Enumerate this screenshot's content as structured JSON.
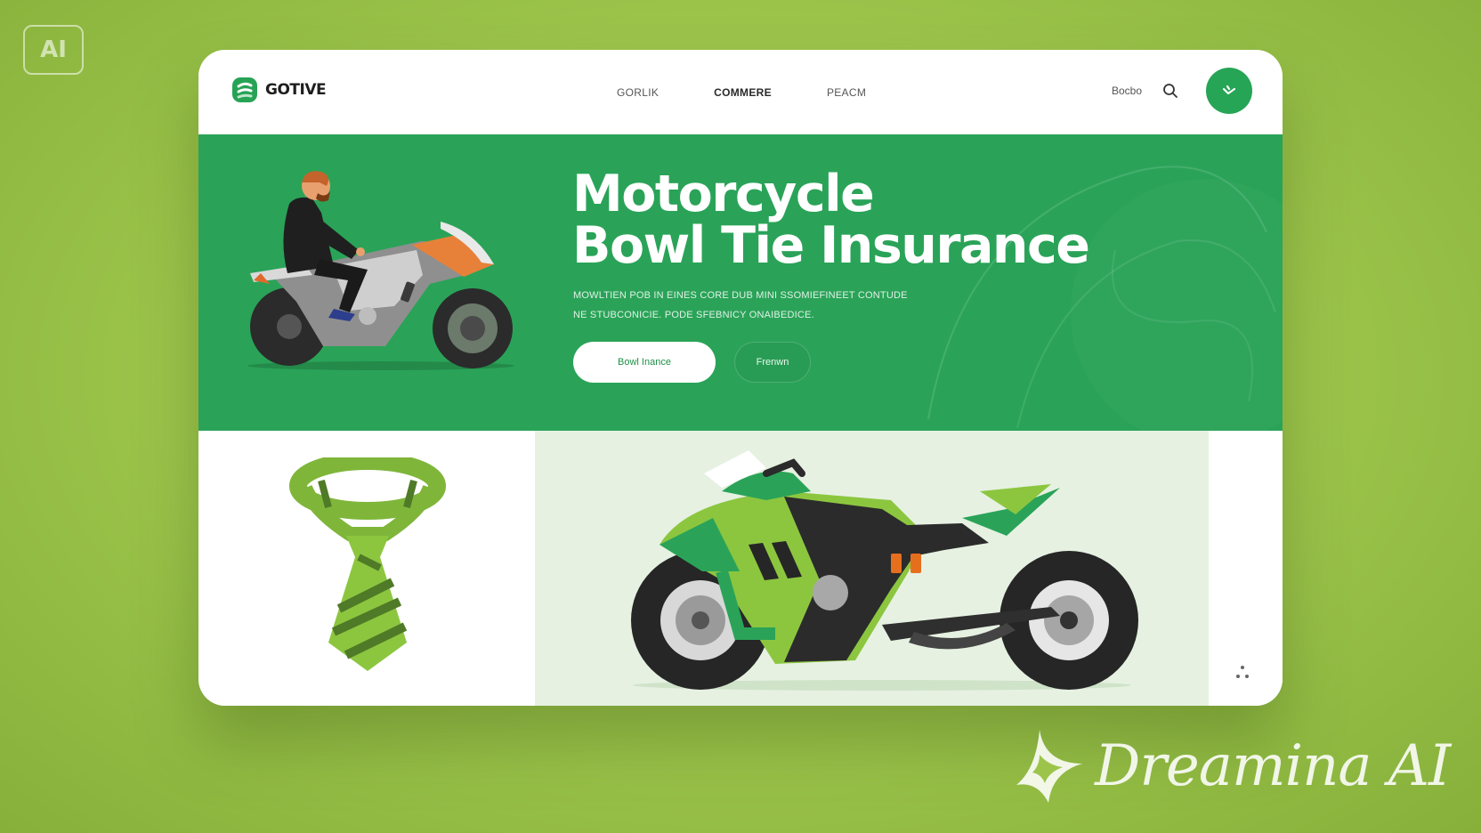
{
  "badge": {
    "text": "AI"
  },
  "nav": {
    "brand": "GOTIVE",
    "links": [
      "GORLIK",
      "COMMERE",
      "PEACM"
    ],
    "search_label": "Bocbo",
    "icons": {
      "search": "search-icon",
      "cta": "phone-icon"
    }
  },
  "hero": {
    "title_line1": "Motorcycle",
    "title_line2": "Bowl Tie Insurance",
    "subtitle_line1": "MOWLTIEN POB IN EINES CORE DUB MINI SSOMIEFINEET CONTUDE",
    "subtitle_line2": "NE STUBCONICIE. PODE SFEBNICY ONAIBEDICE.",
    "primary_button": "Bowl Inance",
    "secondary_button": "Frenwn"
  },
  "watermark": {
    "text": "Dreamina AI"
  },
  "colors": {
    "brand_green": "#2aa358",
    "accent_lime": "#8cc63f",
    "background": "#9cc44b"
  }
}
